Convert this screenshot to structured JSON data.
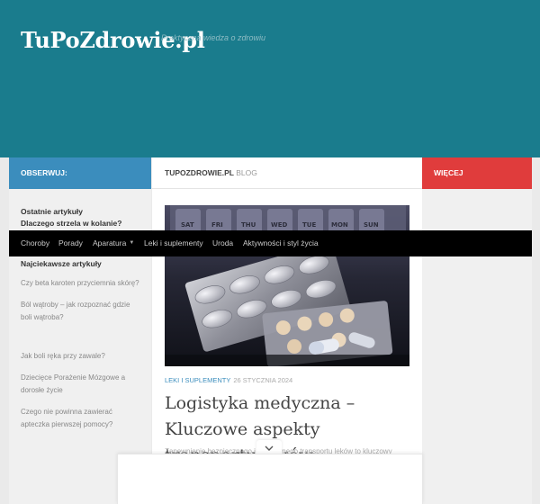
{
  "site": {
    "title": "TuPoZdrowie.pl",
    "tagline": "Praktyczna wiedza o zdrowiu"
  },
  "columns": {
    "left_title": "OBSERWUJ:",
    "middle_title": "TUPOZDROWIE.PL",
    "middle_subtitle": "BLOG",
    "right_title": "WIĘCEJ"
  },
  "nav": {
    "items": [
      {
        "label": "Choroby"
      },
      {
        "label": "Porady"
      },
      {
        "label": "Aparatura",
        "has_dropdown": true
      },
      {
        "label": "Leki i suplementy"
      },
      {
        "label": "Uroda"
      },
      {
        "label": "Aktywności i styl życia"
      }
    ]
  },
  "sidebar_left": {
    "recent_heading": "Ostatnie artykuły",
    "recent_items": [
      "Dlaczego strzela w kolanie?"
    ],
    "popular_heading": "Najciekawsze artykuły",
    "popular_items": [
      "Czy beta karoten przyciemnia skórę?",
      "Ból wątroby – jak rozpoznać gdzie boli wątroba?",
      "Jak boli ręka przy zawale?",
      "Dziecięce Porażenie Mózgowe a dorosłe życie",
      "Czego nie powinna zawierać apteczka pierwszej pomocy?"
    ]
  },
  "post": {
    "category": "LEKI I SUPLEMENTY",
    "date": "26 STYCZNIA 2024",
    "title": "Logistyka medyczna – Kluczowe aspekty transportu leków",
    "excerpt": "Zapewnienie bezpiecznego i efektywnego transportu leków to kluczowy"
  },
  "colors": {
    "header_bg": "#1a7c8d",
    "follow_bar": "#3b8dbd",
    "more_bar": "#e03c3c",
    "nav_bg": "#000000",
    "category": "#3b8dbd"
  },
  "icons": {
    "dropdown": "caret-down-icon",
    "ad_toggle": "chevron-down-icon"
  }
}
